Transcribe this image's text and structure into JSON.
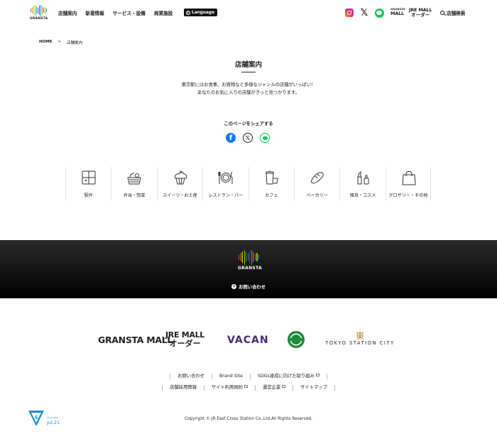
{
  "header": {
    "logo_text": "GRANSTA",
    "logo_bar_colors": [
      "#e94b3c",
      "#f39800",
      "#f7c600",
      "#8fc31f",
      "#00a0e9",
      "#5b5bd6",
      "#e4007f",
      "#00b3a4",
      "#f08300",
      "#e94b3c",
      "#8fc31f",
      "#00a0e9"
    ],
    "nav": [
      "店舗案内",
      "新着情報",
      "サービス・設備",
      "商業施設"
    ],
    "language_label": "Language",
    "social_icons": [
      "instagram-icon",
      "x-icon",
      "line-icon"
    ],
    "granstamall_small": {
      "line1": "GRANSTA",
      "line2": "MALL"
    },
    "jre_order": {
      "line1": "JRE MALL",
      "line2": "オーダー"
    },
    "search_label": "店舗検索"
  },
  "breadcrumb": {
    "home": "HOME",
    "separator": ">",
    "current": "店舗案内"
  },
  "page": {
    "title": "店舗案内",
    "intro_line1": "東京駅にはお食事、お買物など多様なジャンルの店舗がいっぱい！",
    "intro_line2": "あなたのお気に入りの店舗がきっと見つかります。"
  },
  "share": {
    "title": "このページをシェアする",
    "icons": [
      "facebook-icon",
      "x-icon",
      "line-icon"
    ],
    "facebook_glyph": "f",
    "x_glyph": "𝕏"
  },
  "categories": [
    {
      "label": "駅弁",
      "icon": "ekiben-box-icon"
    },
    {
      "label": "弁当・惣菜",
      "icon": "bento-basket-icon"
    },
    {
      "label": "スイーツ・お土産",
      "icon": "cupcake-icon"
    },
    {
      "label": "レストラン・バー",
      "icon": "plate-cutlery-icon"
    },
    {
      "label": "カフェ",
      "icon": "coffee-cup-icon"
    },
    {
      "label": "ベーカリー",
      "icon": "bread-icon"
    },
    {
      "label": "雑貨・コスメ",
      "icon": "cosmetics-icon"
    },
    {
      "label": "グロサリー・その他",
      "icon": "shopping-bag-icon"
    }
  ],
  "band": {
    "logo_text": "GRANSTA",
    "contact_label": "お問い合わせ",
    "contact_icon_glyph": "+"
  },
  "partners": {
    "granstamall": "GRANSTA MALL",
    "jre_order_line1": "JRE MALL",
    "jre_order_line2": "オーダー",
    "vacan": "VACAN",
    "tsc_mark": "東",
    "tsc_text": "TOKYO STATION CITY"
  },
  "footer": {
    "row1": [
      {
        "label": "お問い合わせ",
        "external": false
      },
      {
        "label": "Brand Site",
        "external": false
      },
      {
        "label": "SDGs達成に向けた取り組み",
        "external": true
      }
    ],
    "row2": [
      {
        "label": "店舗採用情報",
        "external": false
      },
      {
        "label": "サイト利用規約",
        "external": true
      },
      {
        "label": "運営企業",
        "external": true
      },
      {
        "label": "サイトマップ",
        "external": false
      }
    ],
    "copyright": "Copyright © JR East Cross Station Co.,Ltd.All Rights Reserved.",
    "badge_line1": "Since Date",
    "badge_line2": "Jul.21"
  },
  "colors": {
    "accent_dark": "#111111",
    "line_green": "#06c755",
    "facebook_blue": "#1877f2",
    "vacan_purple": "#4a2b6e"
  }
}
